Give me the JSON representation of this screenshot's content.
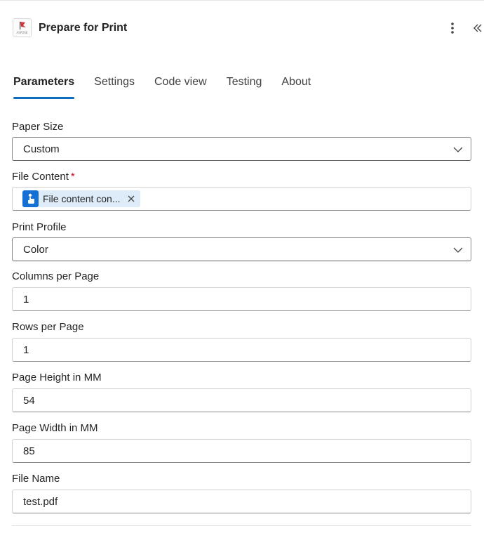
{
  "header": {
    "title": "Prepare for Print",
    "logo_text": "ASPOSE",
    "more_icon": "more-vertical-icon",
    "collapse_icon": "double-chevron-left-icon"
  },
  "tabs": [
    {
      "label": "Parameters",
      "active": true
    },
    {
      "label": "Settings",
      "active": false
    },
    {
      "label": "Code view",
      "active": false
    },
    {
      "label": "Testing",
      "active": false
    },
    {
      "label": "About",
      "active": false
    }
  ],
  "fields": {
    "paper_size": {
      "label": "Paper Size",
      "value": "Custom"
    },
    "file_content": {
      "label": "File Content",
      "required_mark": "*",
      "token_label": "File content con...",
      "token_icon": "connector-icon"
    },
    "print_profile": {
      "label": "Print Profile",
      "value": "Color"
    },
    "columns_per_page": {
      "label": "Columns per Page",
      "value": "1"
    },
    "rows_per_page": {
      "label": "Rows per Page",
      "value": "1"
    },
    "page_height": {
      "label": "Page Height in MM",
      "value": "54"
    },
    "page_width": {
      "label": "Page Width in MM",
      "value": "85"
    },
    "file_name": {
      "label": "File Name",
      "value": "test.pdf"
    }
  },
  "colors": {
    "accent": "#0f6cbd",
    "token_bg": "#deecf9",
    "token_icon_bg": "#1570d6",
    "required": "#c50f1f"
  }
}
